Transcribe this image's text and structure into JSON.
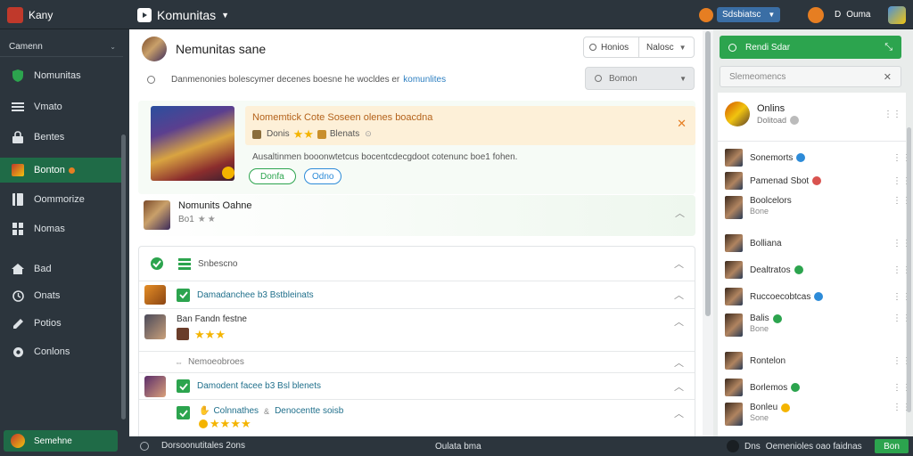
{
  "topbar": {
    "app_name": "Kany",
    "title": "Komunitas",
    "status_label": "Sdsbiatsc",
    "user_label": "D",
    "user_label2": "Ouma"
  },
  "sidebar": {
    "dropdown_label": "Camenn",
    "items": [
      {
        "label": "Nomunitas",
        "icon": "shield-icon"
      },
      {
        "label": "Vmato",
        "icon": "list-icon"
      },
      {
        "label": "Bentes",
        "icon": "lock-icon"
      },
      {
        "label": "Bonton",
        "icon": "user-icon"
      },
      {
        "label": "Oommorize",
        "icon": "book-icon"
      },
      {
        "label": "Nomas",
        "icon": "grid-icon"
      },
      {
        "label": "Bad",
        "icon": "home-icon"
      },
      {
        "label": "Onats",
        "icon": "clock-icon"
      },
      {
        "label": "Potios",
        "icon": "edit-icon"
      },
      {
        "label": "Conlons",
        "icon": "globe-icon"
      }
    ],
    "footer_label": "Semehne"
  },
  "main": {
    "header_title": "Nemunitas sane",
    "header_btn1": "Honios",
    "header_btn2": "Nalosc",
    "search_placeholder": "Danmenonies bolescymer decenes boesne he wocldes er",
    "search_link": "komunlites",
    "search2_label": "Bomon",
    "promo": {
      "title": "Nomemtick Cote Soseen olenes boacdna",
      "sub_label": "Donis",
      "sub_label2": "Blenats",
      "desc": "Ausaltinmen booonwtetcus bocentcdecgdoot cotenunc boe1 fohen.",
      "btn_green": "Donfa",
      "btn_blue": "Odno"
    },
    "friend_card": {
      "name": "Nomunits Oahne",
      "sub": "Bo1"
    },
    "list": {
      "header": "Snbescno",
      "rows": [
        {
          "text": "Damadanchee b3 Bstbleinats"
        },
        {
          "text": "Ban Fandn festne"
        },
        {
          "text": "Nemoeobroes"
        },
        {
          "text": "Damodent facee b3 Bsl blenets"
        },
        {
          "text": "Colnnathes",
          "text2": "Denocentte soisb"
        }
      ]
    }
  },
  "right": {
    "search_btn": "Rendi Sdar",
    "search_placeholder": "Slemeomencs",
    "online_label": "Onlins",
    "online_sub": "Dolitoad",
    "friends": [
      {
        "name": "Sonemorts",
        "status": "#2d8bd8"
      },
      {
        "name": "Pamenad Sbot",
        "status": "#d9534f"
      },
      {
        "name": "Boolcelors",
        "sub": "Bone"
      },
      {
        "name": "Bolliana",
        "status": ""
      },
      {
        "name": "Dealtratos",
        "status": "#2ca44e"
      },
      {
        "name": "Ruccoecobtcas",
        "status": "#2d8bd8"
      },
      {
        "name": "Balis",
        "sub": "Bone",
        "status": "#2ca44e"
      },
      {
        "name": "Rontelon",
        "status": ""
      },
      {
        "name": "Borlemos",
        "status": "#2ca44e"
      },
      {
        "name": "Bonleu",
        "sub": "Sone",
        "status": "#f4b400"
      }
    ]
  },
  "bottombar": {
    "left_text": "Dorsoonutitales 2ons",
    "center_text": "Oulata bma",
    "right_text1": "Dns",
    "right_text2": "Oemenioles oao faidnas",
    "right_button": "Bon"
  },
  "colors": {
    "sidebar_bg": "#2c353d",
    "accent_green": "#2ca44e",
    "accent_blue": "#2d8bd8",
    "promo_bg": "#fdf0d8",
    "star": "#f4b400"
  }
}
